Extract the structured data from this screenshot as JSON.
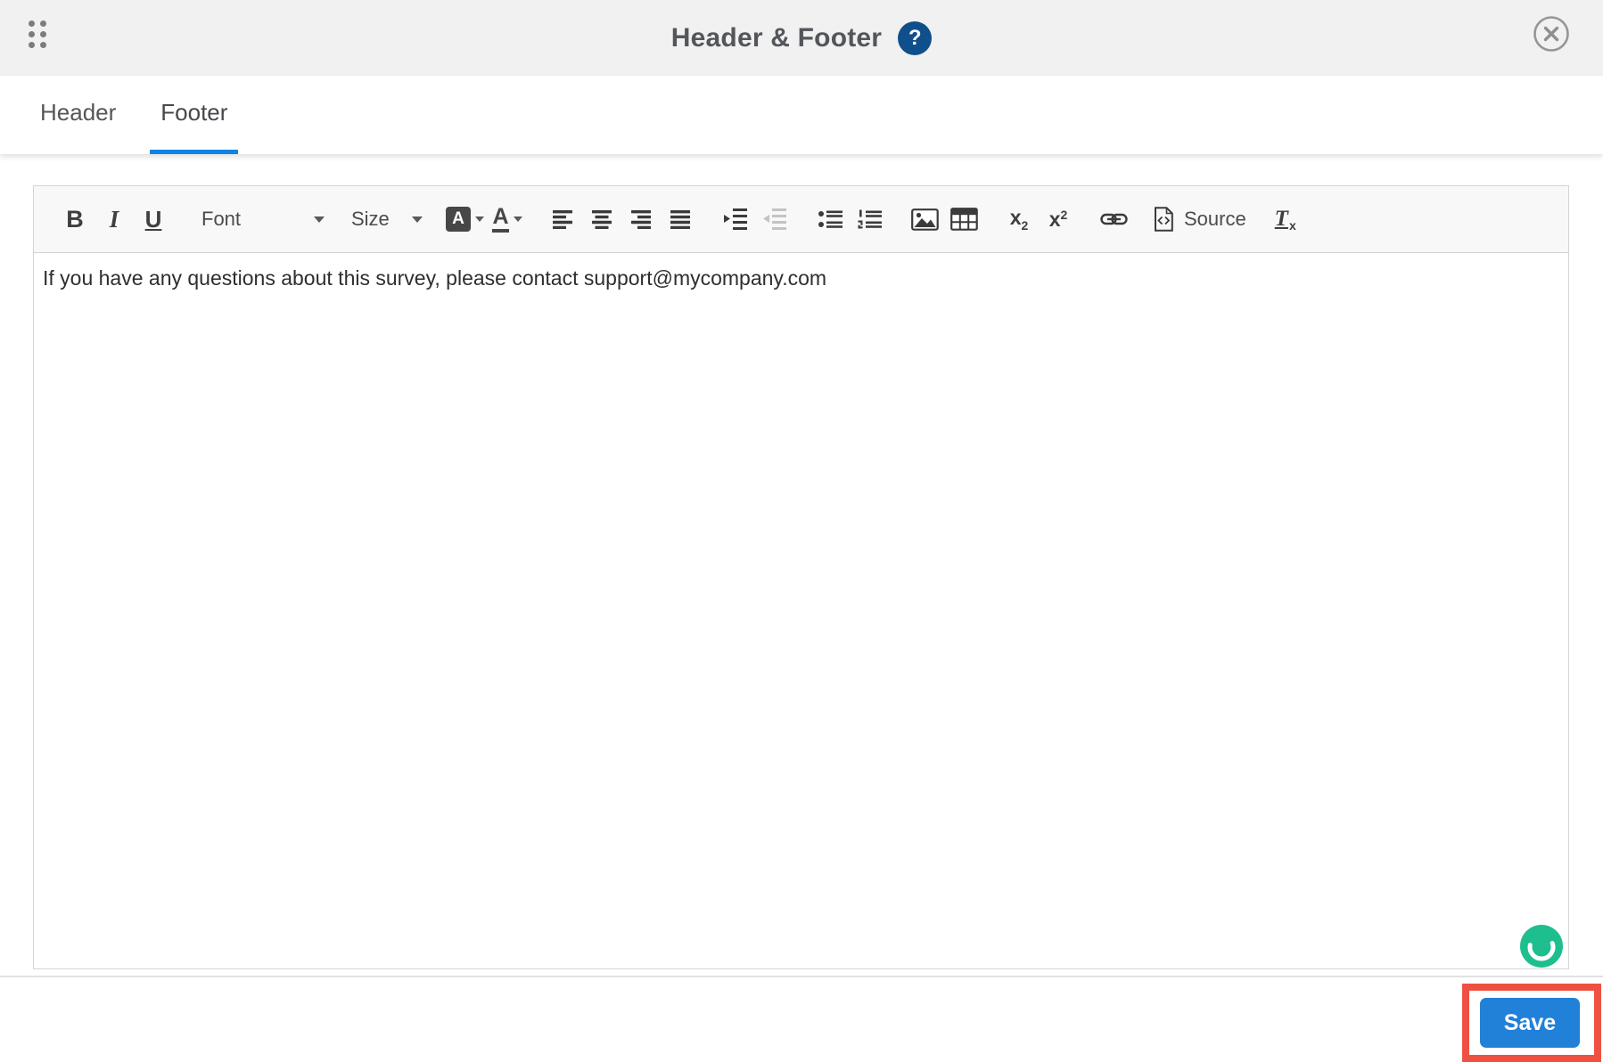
{
  "titlebar": {
    "title": "Header & Footer",
    "help_glyph": "?"
  },
  "tabs": {
    "header_label": "Header",
    "footer_label": "Footer",
    "active_tab": "Footer"
  },
  "toolbar": {
    "bold_label": "B",
    "italic_label": "I",
    "underline_label": "U",
    "font_dropdown_label": "Font",
    "size_dropdown_label": "Size",
    "bgcolor_letter": "A",
    "textcolor_letter": "A",
    "subscript_base": "x",
    "subscript_mark": "2",
    "superscript_base": "x",
    "superscript_mark": "2",
    "source_label": "Source",
    "removeformat_base": "T",
    "removeformat_mark": "x"
  },
  "editor": {
    "content_text": "If you have any questions about this survey, please contact support@mycompany.com"
  },
  "bottombar": {
    "save_label": "Save"
  },
  "colors": {
    "titlebar_bg": "#f1f1f2",
    "tab_active_underline": "#0d84e8",
    "help_icon_bg": "#0f4f8c",
    "toolbar_bg": "#f8f8f8",
    "save_button_bg": "#2181d8",
    "annotation_red": "#ee5142",
    "beacon_green": "#1ebe8f"
  }
}
